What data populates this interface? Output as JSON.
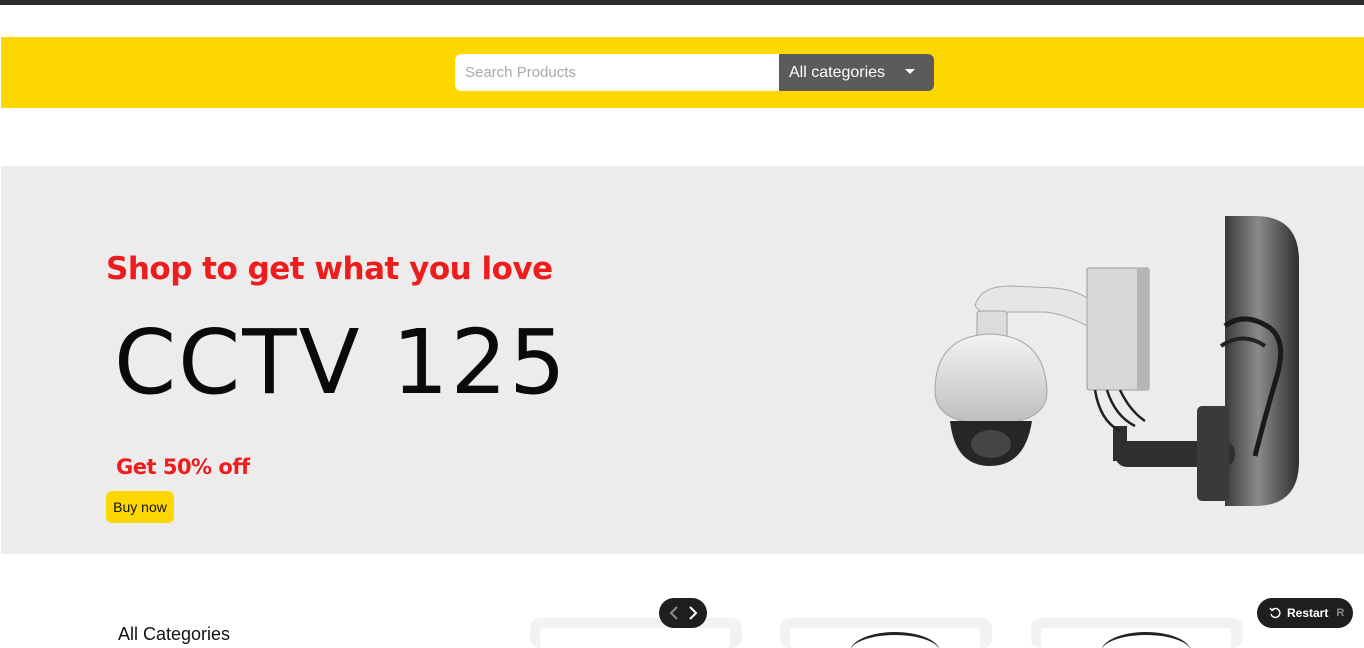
{
  "header": {
    "search": {
      "placeholder": "Search Products",
      "value": ""
    },
    "category_select": {
      "selected": "All categories"
    }
  },
  "hero": {
    "tagline": "Shop to get what you love",
    "product_name": "CCTV 125",
    "offer": "Get 50% off",
    "cta_label": "Buy now",
    "image": "cctv-dome-camera-on-pole"
  },
  "sections": {
    "categories_title": "All Categories"
  },
  "carousel": {
    "prev_icon": "chevron-left-icon",
    "next_icon": "chevron-right-icon"
  },
  "restart": {
    "label": "Restart",
    "shortcut": "R"
  },
  "colors": {
    "brand_yellow": "#fdd700",
    "accent_red": "#ee1c1c",
    "hero_bg": "#ececec",
    "select_bg": "#5b5b5b"
  }
}
